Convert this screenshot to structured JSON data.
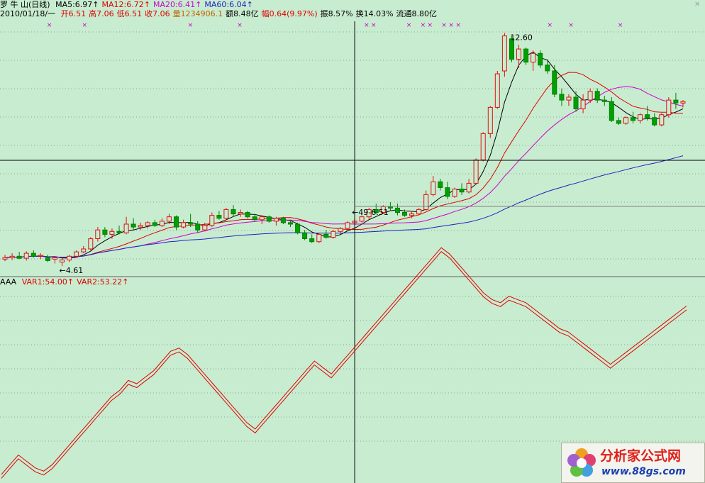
{
  "header": {
    "stock_name": "罗 牛 山(日线)",
    "ma_items": [
      {
        "label": "MA5:6.97",
        "color": "#000000"
      },
      {
        "label": "MA12:6.72",
        "color": "#e00000"
      },
      {
        "label": "MA20:6.41",
        "color": "#cc00cc"
      },
      {
        "label": "MA60:6.04",
        "color": "#2020c0"
      }
    ],
    "date": "2010/01/18/一",
    "quote_items": [
      {
        "label": "开6.51",
        "color": "#e00000"
      },
      {
        "label": "高7.06",
        "color": "#e00000"
      },
      {
        "label": "低6.51",
        "color": "#e00000"
      },
      {
        "label": "收7.06",
        "color": "#e00000"
      },
      {
        "label": "量1234906.1",
        "color": "#c06000"
      },
      {
        "label": "额8.48亿",
        "color": "#000000"
      },
      {
        "label": "幅0.64(9.97%)",
        "color": "#e00000"
      },
      {
        "label": "振8.57%",
        "color": "#000000"
      },
      {
        "label": "换14.03%",
        "color": "#000000"
      },
      {
        "label": "流通8.80亿",
        "color": "#000000"
      }
    ]
  },
  "indicator_header": {
    "name": "AAA",
    "items": [
      {
        "label": "VAR1:54.00",
        "color": "#e00000"
      },
      {
        "label": "VAR2:53.22",
        "color": "#e00000"
      }
    ]
  },
  "price_annotations": {
    "high_label": "12.60",
    "low_label": "←4.61",
    "cursor_label": "←49-6.51"
  },
  "watermark": {
    "cn_text": "分析家公式网",
    "url": "www.88gs.com"
  },
  "chart_data": {
    "type": "candlestick",
    "price_range": [
      4.3,
      13.0
    ],
    "points_count": 96,
    "ohlc": [
      [
        4.85,
        5.0,
        4.78,
        4.9
      ],
      [
        4.9,
        5.05,
        4.82,
        4.95
      ],
      [
        4.95,
        5.1,
        4.85,
        4.88
      ],
      [
        4.88,
        5.12,
        4.8,
        5.05
      ],
      [
        5.05,
        5.15,
        4.9,
        4.95
      ],
      [
        4.95,
        5.05,
        4.85,
        4.98
      ],
      [
        4.9,
        5.0,
        4.75,
        4.8
      ],
      [
        4.85,
        4.95,
        4.7,
        4.9
      ],
      [
        4.75,
        4.9,
        4.61,
        4.82
      ],
      [
        4.82,
        5.0,
        4.75,
        4.95
      ],
      [
        4.95,
        5.15,
        4.9,
        5.1
      ],
      [
        5.1,
        5.3,
        5.05,
        5.2
      ],
      [
        5.2,
        5.6,
        5.15,
        5.55
      ],
      [
        5.55,
        5.95,
        5.45,
        5.85
      ],
      [
        5.85,
        5.95,
        5.6,
        5.7
      ],
      [
        5.7,
        5.9,
        5.55,
        5.8
      ],
      [
        5.8,
        6.0,
        5.7,
        5.75
      ],
      [
        5.75,
        6.3,
        5.7,
        6.05
      ],
      [
        6.05,
        6.25,
        5.85,
        5.95
      ],
      [
        5.95,
        6.1,
        5.85,
        6.0
      ],
      [
        6.0,
        6.15,
        5.9,
        6.1
      ],
      [
        6.1,
        6.2,
        5.95,
        6.0
      ],
      [
        6.0,
        6.25,
        5.95,
        6.15
      ],
      [
        6.15,
        6.4,
        6.05,
        6.3
      ],
      [
        6.3,
        6.35,
        5.85,
        5.95
      ],
      [
        5.95,
        6.2,
        5.9,
        6.1
      ],
      [
        6.1,
        6.4,
        5.95,
        6.05
      ],
      [
        6.05,
        6.15,
        5.75,
        5.85
      ],
      [
        5.85,
        6.1,
        5.8,
        6.0
      ],
      [
        6.0,
        6.45,
        5.95,
        6.35
      ],
      [
        6.35,
        6.5,
        6.2,
        6.25
      ],
      [
        6.25,
        6.6,
        6.2,
        6.55
      ],
      [
        6.55,
        6.7,
        6.3,
        6.4
      ],
      [
        6.4,
        6.55,
        6.3,
        6.45
      ],
      [
        6.45,
        6.5,
        6.25,
        6.3
      ],
      [
        6.3,
        6.4,
        6.15,
        6.2
      ],
      [
        6.2,
        6.35,
        6.05,
        6.3
      ],
      [
        6.3,
        6.35,
        6.1,
        6.15
      ],
      [
        6.15,
        6.3,
        6.0,
        6.25
      ],
      [
        6.25,
        6.3,
        6.05,
        6.1
      ],
      [
        6.1,
        6.2,
        5.95,
        6.05
      ],
      [
        6.05,
        6.1,
        5.7,
        5.75
      ],
      [
        5.75,
        5.85,
        5.5,
        5.55
      ],
      [
        5.55,
        5.7,
        5.4,
        5.45
      ],
      [
        5.45,
        5.75,
        5.4,
        5.7
      ],
      [
        5.7,
        5.85,
        5.55,
        5.6
      ],
      [
        5.6,
        5.85,
        5.55,
        5.8
      ],
      [
        5.8,
        5.95,
        5.7,
        5.9
      ],
      [
        5.9,
        6.15,
        5.85,
        6.1
      ],
      [
        6.1,
        6.25,
        6.0,
        6.15
      ],
      [
        6.15,
        6.35,
        6.1,
        6.3
      ],
      [
        6.3,
        6.6,
        6.2,
        6.55
      ],
      [
        6.55,
        6.75,
        6.4,
        6.45
      ],
      [
        6.45,
        6.7,
        6.4,
        6.65
      ],
      [
        6.65,
        6.8,
        6.5,
        6.6
      ],
      [
        6.6,
        6.75,
        6.35,
        6.45
      ],
      [
        6.45,
        6.55,
        6.3,
        6.35
      ],
      [
        6.35,
        6.5,
        6.25,
        6.4
      ],
      [
        6.4,
        6.6,
        6.35,
        6.55
      ],
      [
        6.55,
        7.2,
        6.51,
        7.06
      ],
      [
        7.06,
        7.7,
        7.0,
        7.5
      ],
      [
        7.5,
        7.6,
        7.2,
        7.3
      ],
      [
        7.3,
        7.5,
        6.9,
        7.0
      ],
      [
        7.0,
        7.3,
        6.95,
        7.25
      ],
      [
        7.25,
        7.45,
        7.05,
        7.15
      ],
      [
        7.15,
        7.6,
        7.1,
        7.45
      ],
      [
        7.45,
        8.3,
        7.4,
        8.25
      ],
      [
        8.25,
        9.2,
        8.2,
        9.15
      ],
      [
        9.15,
        10.1,
        9.0,
        10.05
      ],
      [
        10.05,
        11.3,
        10.0,
        11.2
      ],
      [
        11.3,
        12.6,
        11.1,
        12.5
      ],
      [
        12.4,
        12.5,
        11.6,
        11.7
      ],
      [
        11.7,
        12.2,
        11.4,
        12.05
      ],
      [
        12.05,
        12.1,
        11.5,
        11.6
      ],
      [
        11.6,
        12.0,
        11.3,
        11.9
      ],
      [
        11.9,
        12.0,
        11.4,
        11.5
      ],
      [
        11.5,
        11.7,
        11.2,
        11.3
      ],
      [
        11.3,
        11.5,
        10.4,
        10.5
      ],
      [
        10.5,
        10.7,
        10.1,
        10.3
      ],
      [
        10.3,
        10.5,
        10.1,
        10.4
      ],
      [
        10.4,
        10.6,
        9.9,
        10.0
      ],
      [
        10.0,
        10.5,
        9.85,
        10.3
      ],
      [
        10.3,
        10.7,
        10.2,
        10.6
      ],
      [
        10.6,
        10.7,
        10.2,
        10.3
      ],
      [
        10.3,
        10.45,
        10.1,
        10.25
      ],
      [
        10.25,
        10.4,
        9.55,
        9.6
      ],
      [
        9.6,
        9.7,
        9.45,
        9.5
      ],
      [
        9.5,
        9.75,
        9.45,
        9.7
      ],
      [
        9.7,
        9.9,
        9.5,
        9.6
      ],
      [
        9.6,
        9.85,
        9.5,
        9.8
      ],
      [
        9.8,
        10.1,
        9.6,
        9.7
      ],
      [
        9.7,
        9.85,
        9.4,
        9.45
      ],
      [
        9.45,
        9.85,
        9.4,
        9.8
      ],
      [
        9.8,
        10.4,
        9.7,
        10.3
      ],
      [
        10.3,
        10.55,
        10.0,
        10.2
      ],
      [
        10.2,
        10.3,
        10.05,
        10.25
      ]
    ],
    "ma_series": [
      {
        "name": "MA5",
        "color": "#000000"
      },
      {
        "name": "MA12",
        "color": "#e00000"
      },
      {
        "name": "MA20",
        "color": "#cc00cc"
      },
      {
        "name": "MA60",
        "color": "#2020c0"
      }
    ],
    "indicator": {
      "name": "AAA",
      "y_range": [
        0,
        60
      ],
      "var1": [
        2,
        5,
        8,
        6,
        4,
        3,
        5,
        8,
        11,
        14,
        17,
        20,
        23,
        26,
        28,
        31,
        30,
        32,
        34,
        37,
        40,
        41,
        39,
        36,
        33,
        30,
        27,
        24,
        21,
        18,
        16,
        19,
        22,
        25,
        28,
        31,
        34,
        37,
        35,
        33,
        36,
        39,
        42,
        45,
        48,
        51,
        54,
        57,
        60,
        63,
        66,
        69,
        72,
        70,
        67,
        64,
        61,
        58,
        56,
        55,
        57,
        56,
        55,
        53,
        51,
        49,
        47,
        46,
        44,
        42,
        40,
        38,
        36,
        38,
        40,
        42,
        44,
        46,
        48,
        50,
        52,
        54
      ],
      "var2_offset": 1.2,
      "series_names": [
        "VAR1",
        "VAR2"
      ]
    },
    "markers_x_fraction": [
      0.07,
      0.12,
      0.27,
      0.34,
      0.52,
      0.53,
      0.58,
      0.6,
      0.61,
      0.63,
      0.64,
      0.65,
      0.78,
      0.81,
      0.88
    ]
  }
}
